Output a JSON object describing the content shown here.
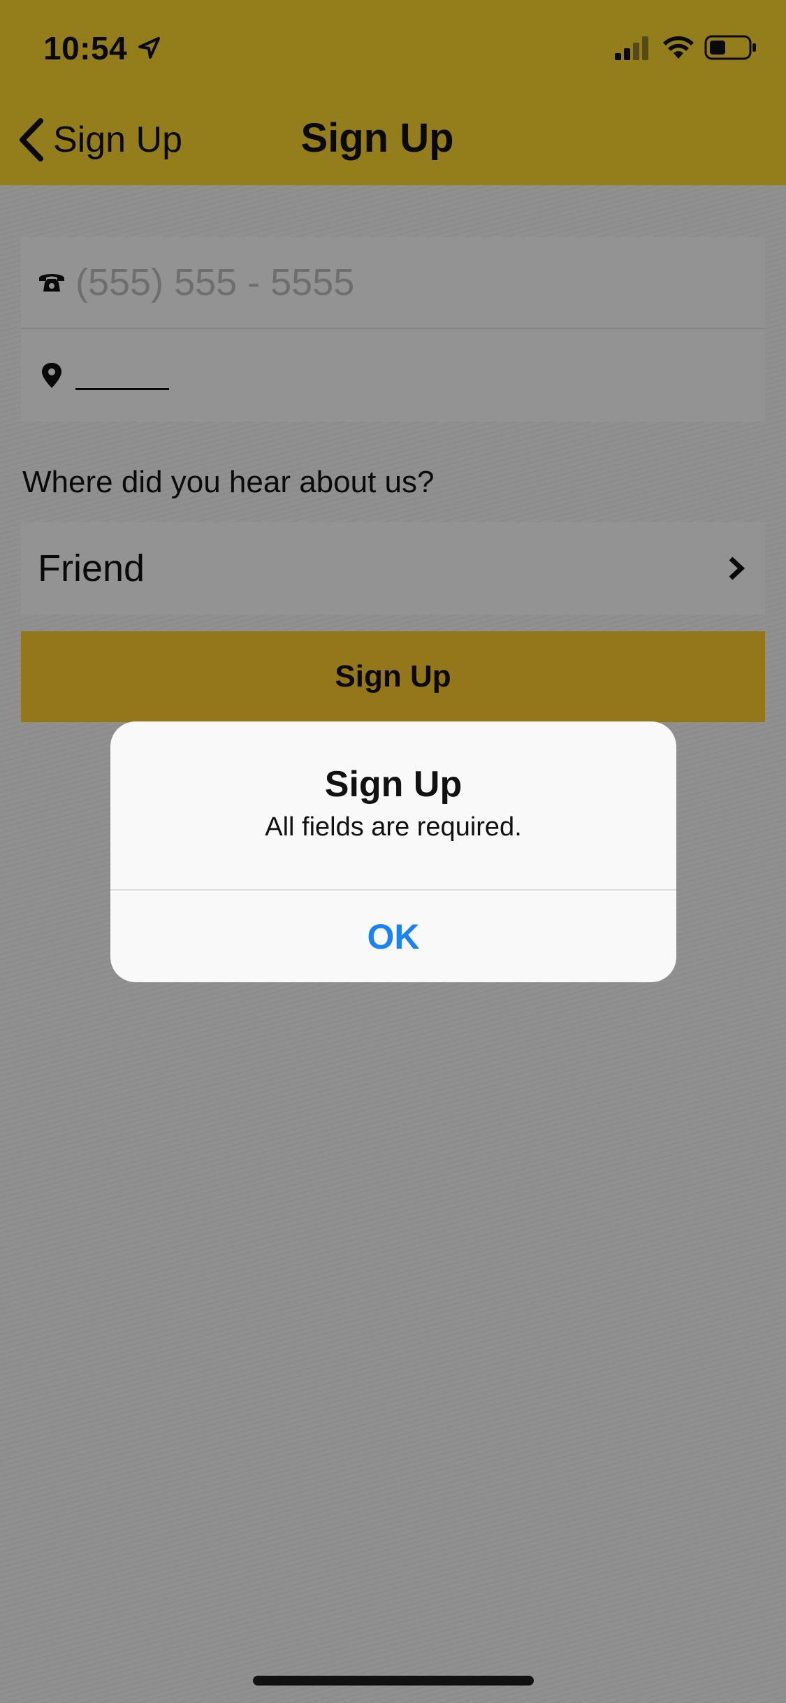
{
  "status_bar": {
    "time": "10:54",
    "icons": [
      "location-arrow-icon",
      "cellular-signal-icon",
      "wifi-icon",
      "battery-icon"
    ]
  },
  "nav": {
    "back_label": "Sign Up",
    "title": "Sign Up"
  },
  "form": {
    "phone": {
      "icon": "phone-icon",
      "value": "",
      "placeholder": "(555) 555 - 5555"
    },
    "zip": {
      "icon": "map-pin-icon",
      "value": ""
    },
    "referral": {
      "question": "Where did you hear about us?",
      "selected": "Friend",
      "icon": "chevron-right-icon"
    },
    "submit_label": "Sign Up"
  },
  "alert": {
    "title": "Sign Up",
    "message": "All fields are required.",
    "ok_label": "OK"
  },
  "colors": {
    "header": "#f7d22f",
    "button": "#f7c52e",
    "alert_action": "#1a82f7"
  }
}
